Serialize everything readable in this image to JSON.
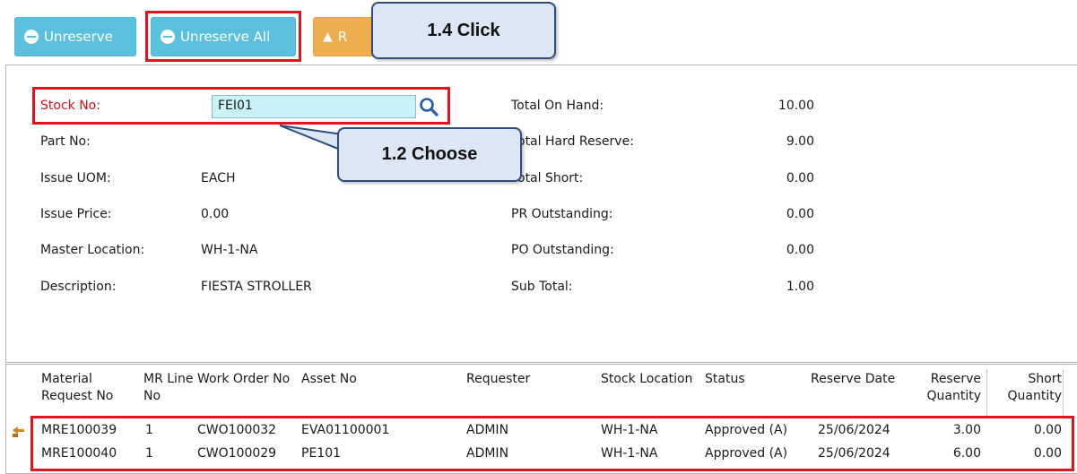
{
  "toolbar": {
    "unreserve_label": "Unreserve",
    "unreserve_all_label": "Unreserve All",
    "partial_button_label": "R"
  },
  "callouts": {
    "click": "1.4 Click",
    "choose": "1.2 Choose"
  },
  "form": {
    "stock_no_label": "Stock No:",
    "stock_no_value": "FEI01",
    "part_no_label": "Part No:",
    "issue_uom_label": "Issue UOM:",
    "issue_uom_value": "EACH",
    "issue_price_label": "Issue Price:",
    "issue_price_value": "0.00",
    "master_location_label": "Master Location:",
    "master_location_value": "WH-1-NA",
    "description_label": "Description:",
    "description_value": "FIESTA STROLLER"
  },
  "totals": {
    "on_hand_label": "Total On Hand:",
    "on_hand_value": "10.00",
    "hard_reserve_label": "otal Hard Reserve:",
    "hard_reserve_value": "9.00",
    "short_label": "otal Short:",
    "short_value": "0.00",
    "pr_outstanding_label": "PR Outstanding:",
    "pr_outstanding_value": "0.00",
    "po_outstanding_label": "PO Outstanding:",
    "po_outstanding_value": "0.00",
    "sub_total_label": "Sub Total:",
    "sub_total_value": "1.00"
  },
  "table": {
    "headers": {
      "material_request_no_1": "Material",
      "material_request_no_2": "Request No",
      "mr_line_no_1": "MR Line",
      "mr_line_no_2": "No",
      "work_order_no": "Work Order No",
      "asset_no": "Asset No",
      "requester": "Requester",
      "stock_location": "Stock Location",
      "status": "Status",
      "reserve_date": "Reserve Date",
      "reserve_quantity_1": "Reserve",
      "reserve_quantity_2": "Quantity",
      "short_quantity_1": "Short",
      "short_quantity_2": "Quantity"
    },
    "rows": [
      {
        "material_request_no": "MRE100039",
        "mr_line_no": "1",
        "work_order_no": "CWO100032",
        "asset_no": "EVA01100001",
        "requester": "ADMIN",
        "stock_location": "WH-1-NA",
        "status": "Approved (A)",
        "reserve_date": "25/06/2024",
        "reserve_quantity": "3.00",
        "short_quantity": "0.00"
      },
      {
        "material_request_no": "MRE100040",
        "mr_line_no": "1",
        "work_order_no": "CWO100029",
        "asset_no": "PE101",
        "requester": "ADMIN",
        "stock_location": "WH-1-NA",
        "status": "Approved (A)",
        "reserve_date": "25/06/2024",
        "reserve_quantity": "6.00",
        "short_quantity": "0.00"
      }
    ]
  },
  "colors": {
    "button_blue": "#5bc0de",
    "button_orange": "#f0ad4e",
    "highlight_red": "#e0141e",
    "callout_fill": "#dce6f4",
    "input_fill": "#c8f1f8"
  }
}
